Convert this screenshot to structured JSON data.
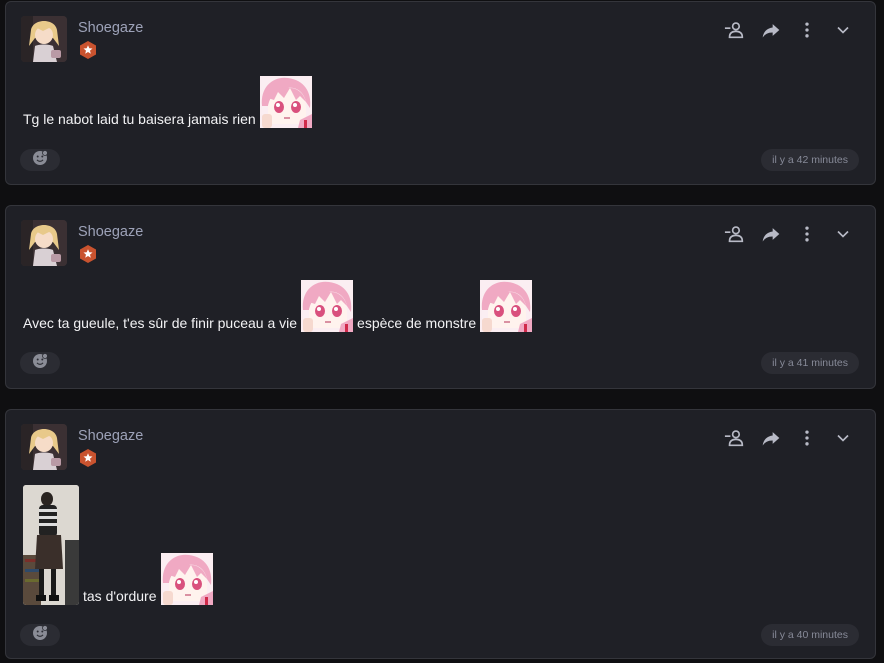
{
  "posts": [
    {
      "username": "Shoegaze",
      "segments": [
        "Tg le nabot laid tu baisera jamais rien"
      ],
      "timestamp": "il y a 42 minutes"
    },
    {
      "username": "Shoegaze",
      "segments": [
        "Avec ta gueule, t'es sûr de finir puceau a vie",
        "espèce de monstre"
      ],
      "timestamp": "il y a 41 minutes"
    },
    {
      "username": "Shoegaze",
      "segments": [
        "tas d'ordure"
      ],
      "timestamp": "il y a 40 minutes"
    }
  ],
  "icons": {
    "follow": "person-remove-icon",
    "share": "share-icon",
    "more": "more-vertical-icon",
    "expand": "chevron-down-icon",
    "badge": "star-badge-icon",
    "reaction": "smiley-icon"
  },
  "colors": {
    "card": "#1f2026",
    "badge": "#c9532f",
    "username": "#9da2b8"
  }
}
